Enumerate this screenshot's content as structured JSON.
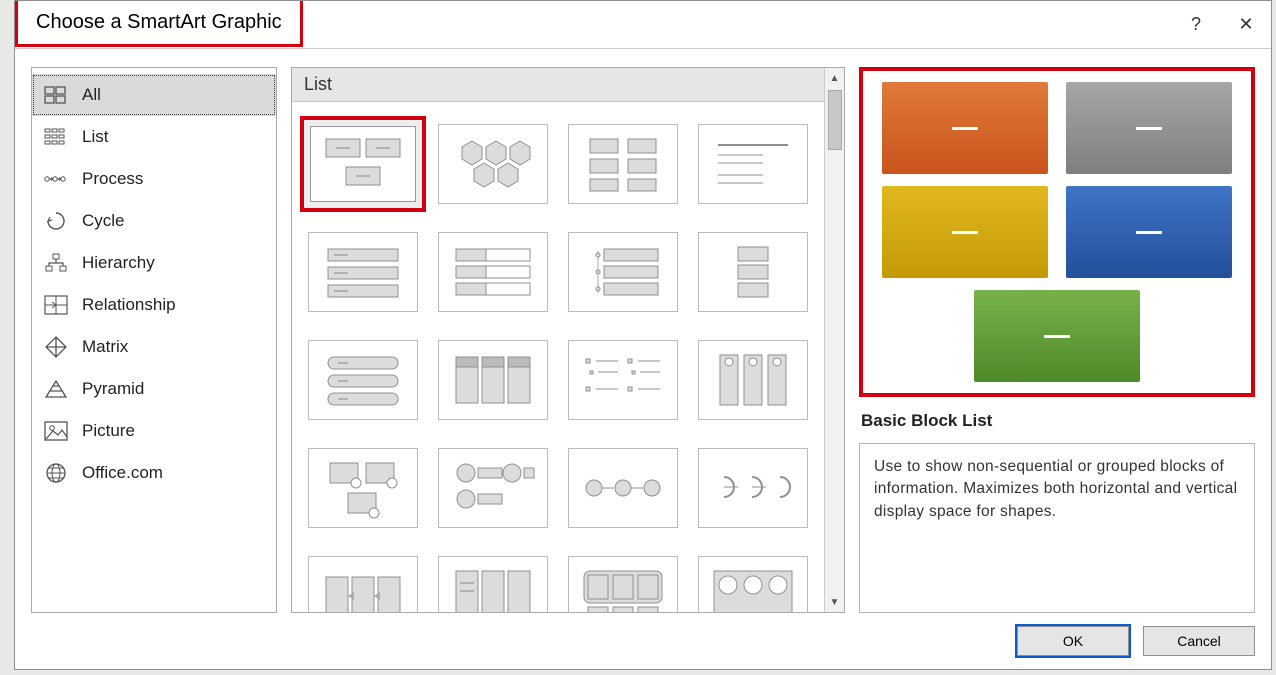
{
  "dialog": {
    "title": "Choose a SmartArt Graphic",
    "help_icon": "?",
    "close_icon": "✕"
  },
  "sidebar": {
    "items": [
      {
        "label": "All",
        "icon": "all",
        "selected": true
      },
      {
        "label": "List",
        "icon": "list",
        "selected": false
      },
      {
        "label": "Process",
        "icon": "process",
        "selected": false
      },
      {
        "label": "Cycle",
        "icon": "cycle",
        "selected": false
      },
      {
        "label": "Hierarchy",
        "icon": "hierarchy",
        "selected": false
      },
      {
        "label": "Relationship",
        "icon": "relationship",
        "selected": false
      },
      {
        "label": "Matrix",
        "icon": "matrix",
        "selected": false
      },
      {
        "label": "Pyramid",
        "icon": "pyramid",
        "selected": false
      },
      {
        "label": "Picture",
        "icon": "picture",
        "selected": false
      },
      {
        "label": "Office.com",
        "icon": "globe",
        "selected": false
      }
    ]
  },
  "gallery": {
    "header": "List",
    "selected_index": 0,
    "thumbs": [
      "basic-block",
      "hexagon",
      "lined-list",
      "text-lines",
      "stacked-bars",
      "bar-rows",
      "tab-list",
      "vert-box",
      "card-list",
      "column-list",
      "bullets",
      "pillars",
      "pic-list",
      "orb-list",
      "circle-arrow",
      "semi-circles",
      "vert-box2",
      "column-list2",
      "box-row",
      "process-circles"
    ]
  },
  "preview": {
    "title": "Basic Block List",
    "description": "Use to show non-sequential or grouped blocks of information. Maximizes both horizontal and vertical display space for shapes.",
    "blocks": [
      {
        "color": "orange"
      },
      {
        "color": "gray"
      },
      {
        "color": "yellow"
      },
      {
        "color": "blue"
      },
      {
        "color": "green"
      }
    ]
  },
  "buttons": {
    "ok": "OK",
    "cancel": "Cancel"
  }
}
